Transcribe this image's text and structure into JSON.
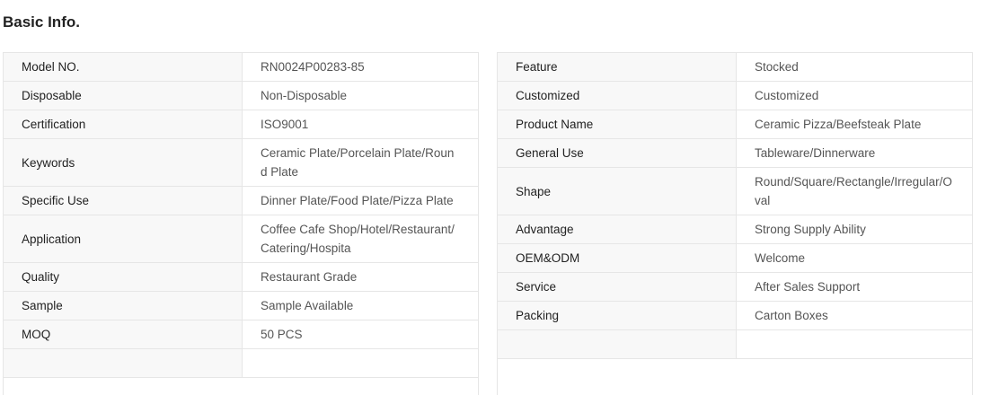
{
  "section_title": "Basic Info.",
  "left_rows": [
    {
      "key": "Model NO.",
      "value": "RN0024P00283-85"
    },
    {
      "key": "Disposable",
      "value": "Non-Disposable"
    },
    {
      "key": "Certification",
      "value": "ISO9001"
    },
    {
      "key": "Keywords",
      "value": "Ceramic Plate/Porcelain Plate/Round Plate"
    },
    {
      "key": "Specific Use",
      "value": "Dinner Plate/Food Plate/Pizza Plate"
    },
    {
      "key": "Application",
      "value": "Coffee Cafe Shop/Hotel/Restaurant/Catering/Hospita"
    },
    {
      "key": "Quality",
      "value": "Restaurant Grade"
    },
    {
      "key": "Sample",
      "value": "Sample Available"
    },
    {
      "key": "MOQ",
      "value": "50 PCS"
    },
    {
      "key": "",
      "value": ""
    }
  ],
  "right_rows": [
    {
      "key": "Feature",
      "value": "Stocked"
    },
    {
      "key": "Customized",
      "value": "Customized"
    },
    {
      "key": "Product Name",
      "value": "Ceramic Pizza/Beefsteak Plate"
    },
    {
      "key": "General Use",
      "value": "Tableware/Dinnerware"
    },
    {
      "key": "Shape",
      "value": "Round/Square/Rectangle/Irregular/Oval"
    },
    {
      "key": "Advantage",
      "value": "Strong Supply Ability"
    },
    {
      "key": "OEM&ODM",
      "value": "Welcome"
    },
    {
      "key": "Service",
      "value": "After Sales Support"
    },
    {
      "key": "Packing",
      "value": "Carton Boxes"
    },
    {
      "key": "",
      "value": ""
    }
  ]
}
